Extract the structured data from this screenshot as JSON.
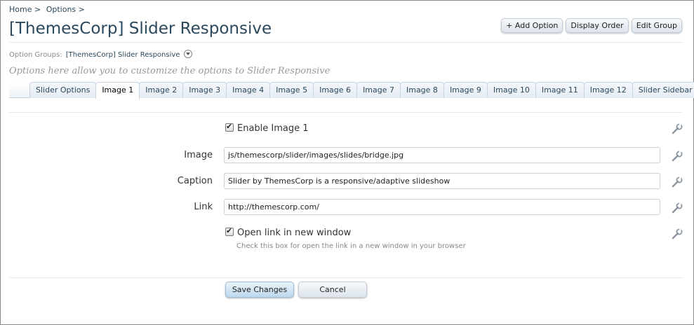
{
  "breadcrumb": {
    "home": "Home >",
    "options": "Options >"
  },
  "page": {
    "title": "[ThemesCorp] Slider Responsive",
    "description": "Options here allow you to customize the options to Slider Responsive"
  },
  "top_buttons": {
    "add_option": "+ Add Option",
    "display_order": "Display Order",
    "edit_group": "Edit Group"
  },
  "option_groups": {
    "label": "Option Groups:",
    "value": "[ThemesCorp] Slider Responsive"
  },
  "tabs": [
    {
      "label": "Slider Options"
    },
    {
      "label": "Image 1"
    },
    {
      "label": "Image 2"
    },
    {
      "label": "Image 3"
    },
    {
      "label": "Image 4"
    },
    {
      "label": "Image 5"
    },
    {
      "label": "Image 6"
    },
    {
      "label": "Image 7"
    },
    {
      "label": "Image 8"
    },
    {
      "label": "Image 9"
    },
    {
      "label": "Image 10"
    },
    {
      "label": "Image 11"
    },
    {
      "label": "Image 12"
    },
    {
      "label": "Slider Sidebar"
    }
  ],
  "active_tab": "Image 1",
  "form": {
    "enable_label": "Enable Image 1",
    "image_label": "Image",
    "image_value": "js/themescorp/slider/images/slides/bridge.jpg",
    "caption_label": "Caption",
    "caption_value": "Slider by ThemesCorp is a responsive/adaptive slideshow",
    "link_label": "Link",
    "link_value": "http://themescorp.com/",
    "new_window_label": "Open link in new window",
    "new_window_hint": "Check this box for open the link in a new window in your browser"
  },
  "actions": {
    "save": "Save Changes",
    "cancel": "Cancel"
  },
  "icons": {
    "edit": "wrench-icon",
    "dropdown": "chevron-down-icon"
  },
  "colors": {
    "accent": "#2b485c",
    "tab_border": "#c6d4e1",
    "save_bg": "#bcd8ee"
  }
}
